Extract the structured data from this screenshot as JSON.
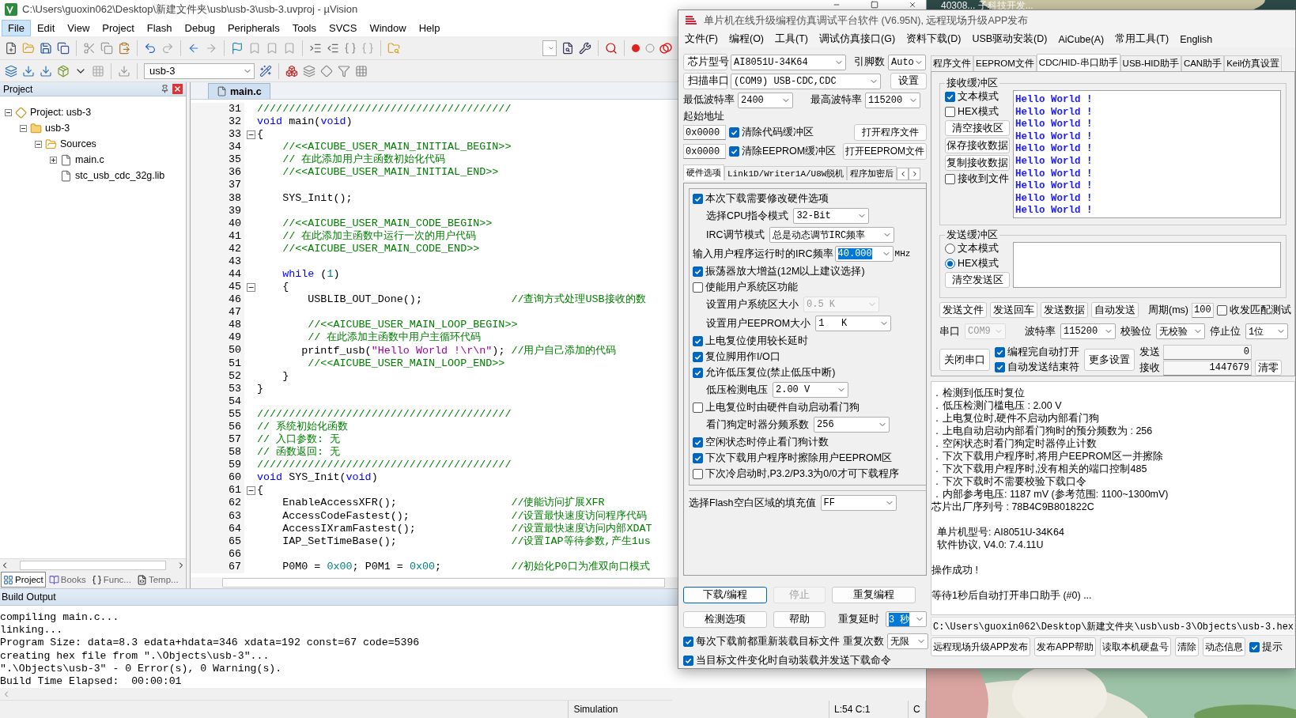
{
  "keil": {
    "title": "C:\\Users\\guoxin062\\Desktop\\新建文件夹\\usb\\usb-3\\usb-3.uvproj - µVision",
    "menu": [
      {
        "label": "File",
        "selected": true
      },
      {
        "label": "Edit",
        "selected": false
      },
      {
        "label": "View",
        "selected": false
      },
      {
        "label": "Project",
        "selected": false
      },
      {
        "label": "Flash",
        "selected": false
      },
      {
        "label": "Debug",
        "selected": false
      },
      {
        "label": "Peripherals",
        "selected": false
      },
      {
        "label": "Tools",
        "selected": false
      },
      {
        "label": "SVCS",
        "selected": false
      },
      {
        "label": "Window",
        "selected": false
      },
      {
        "label": "Help",
        "selected": false
      }
    ],
    "target": "usb-3",
    "project": {
      "title": "Project",
      "tree": [
        {
          "label": "Project: usb-3",
          "kind": "project",
          "expanded": true,
          "children": [
            {
              "label": "usb-3",
              "kind": "target",
              "expanded": true,
              "children": [
                {
                  "label": "Sources",
                  "kind": "folder",
                  "expanded": true,
                  "children": [
                    {
                      "label": "main.c",
                      "kind": "file",
                      "expanded": false
                    },
                    {
                      "label": "stc_usb_cdc_32g.lib",
                      "kind": "file"
                    }
                  ]
                }
              ]
            }
          ]
        }
      ],
      "tabs": [
        {
          "label": "Project",
          "kind": "project",
          "selected": true
        },
        {
          "label": "Books",
          "kind": "books",
          "selected": false
        },
        {
          "label": "Func...",
          "kind": "functions",
          "selected": false
        },
        {
          "label": "Temp...",
          "kind": "templates",
          "selected": false
        }
      ]
    },
    "editor": {
      "tab": "main.c",
      "lines": [
        {
          "number": "31",
          "fold": false,
          "segments": [
            {
              "kind": "comment",
              "text": "////////////////////////////////////////"
            }
          ]
        },
        {
          "number": "32",
          "fold": false,
          "segments": [
            {
              "kind": "keyword",
              "text": "void"
            },
            {
              "kind": "code",
              "text": " main("
            },
            {
              "kind": "keyword",
              "text": "void"
            },
            {
              "kind": "code",
              "text": ")"
            }
          ]
        },
        {
          "number": "33",
          "fold": true,
          "segments": [
            {
              "kind": "code",
              "text": "{"
            }
          ]
        },
        {
          "number": "34",
          "fold": false,
          "segments": [
            {
              "kind": "comment",
              "text": "    //<<AICUBE_USER_MAIN_INITIAL_BEGIN>>"
            }
          ]
        },
        {
          "number": "35",
          "fold": false,
          "segments": [
            {
              "kind": "comment",
              "text": "    // 在此添加用户主函数初始化代码"
            }
          ]
        },
        {
          "number": "36",
          "fold": false,
          "segments": [
            {
              "kind": "comment",
              "text": "    //<<AICUBE_USER_MAIN_INITIAL_END>>"
            }
          ]
        },
        {
          "number": "37",
          "fold": false
        },
        {
          "number": "38",
          "fold": false,
          "segments": [
            {
              "kind": "code",
              "text": "    SYS_Init();"
            }
          ]
        },
        {
          "number": "39",
          "fold": false
        },
        {
          "number": "40",
          "fold": false,
          "segments": [
            {
              "kind": "comment",
              "text": "    //<<AICUBE_USER_MAIN_CODE_BEGIN>>"
            }
          ]
        },
        {
          "number": "41",
          "fold": false,
          "segments": [
            {
              "kind": "comment",
              "text": "    // 在此添加主函数中运行一次的用户代码"
            }
          ]
        },
        {
          "number": "42",
          "fold": false,
          "segments": [
            {
              "kind": "comment",
              "text": "    //<<AICUBE_USER_MAIN_CODE_END>>"
            }
          ]
        },
        {
          "number": "43",
          "fold": false
        },
        {
          "number": "44",
          "fold": false,
          "segments": [
            {
              "kind": "keyword",
              "text": "    while"
            },
            {
              "kind": "code",
              "text": " ("
            },
            {
              "kind": "number",
              "text": "1"
            },
            {
              "kind": "code",
              "text": ")"
            }
          ]
        },
        {
          "number": "45",
          "fold": true,
          "segments": [
            {
              "kind": "code",
              "text": "    {"
            }
          ]
        },
        {
          "number": "46",
          "fold": false,
          "segments": [
            {
              "kind": "code",
              "text": "        USBLIB_OUT_Done();"
            }
          ],
          "note": "//查询方式处理USB接收的数"
        },
        {
          "number": "47",
          "fold": false
        },
        {
          "number": "48",
          "fold": false,
          "segments": [
            {
              "kind": "comment",
              "text": "        //<<AICUBE_USER_MAIN_LOOP_BEGIN>>"
            }
          ]
        },
        {
          "number": "49",
          "fold": false,
          "segments": [
            {
              "kind": "comment",
              "text": "        // 在此添加主函数中用户主循环代码"
            }
          ]
        },
        {
          "number": "50",
          "fold": false,
          "segments": [
            {
              "kind": "code",
              "text": "       printf_usb("
            },
            {
              "kind": "string",
              "text": "\"Hello World !\\r\\n\""
            },
            {
              "kind": "code",
              "text": ");"
            }
          ],
          "note": "//用户自己添加的代码"
        },
        {
          "number": "51",
          "fold": false,
          "segments": [
            {
              "kind": "comment",
              "text": "        //<<AICUBE_USER_MAIN_LOOP_END>>"
            }
          ]
        },
        {
          "number": "52",
          "fold": false,
          "segments": [
            {
              "kind": "code",
              "text": "    }"
            }
          ]
        },
        {
          "number": "53",
          "fold": false,
          "segments": [
            {
              "kind": "code",
              "text": "}"
            }
          ]
        },
        {
          "number": "54",
          "fold": false
        },
        {
          "number": "55",
          "fold": false,
          "segments": [
            {
              "kind": "comment",
              "text": "////////////////////////////////////////"
            }
          ]
        },
        {
          "number": "56",
          "fold": false,
          "segments": [
            {
              "kind": "comment",
              "text": "// 系统初始化函数"
            }
          ]
        },
        {
          "number": "57",
          "fold": false,
          "segments": [
            {
              "kind": "comment",
              "text": "// 入口参数: 无"
            }
          ]
        },
        {
          "number": "58",
          "fold": false,
          "segments": [
            {
              "kind": "comment",
              "text": "// 函数返回: 无"
            }
          ]
        },
        {
          "number": "59",
          "fold": false,
          "segments": [
            {
              "kind": "comment",
              "text": "////////////////////////////////////////"
            }
          ]
        },
        {
          "number": "60",
          "fold": false,
          "segments": [
            {
              "kind": "keyword",
              "text": "void"
            },
            {
              "kind": "code",
              "text": " SYS_Init("
            },
            {
              "kind": "keyword",
              "text": "void"
            },
            {
              "kind": "code",
              "text": ")"
            }
          ]
        },
        {
          "number": "61",
          "fold": true,
          "segments": [
            {
              "kind": "code",
              "text": "{"
            }
          ]
        },
        {
          "number": "62",
          "fold": false,
          "segments": [
            {
              "kind": "code",
              "text": "    EnableAccessXFR();"
            }
          ],
          "note": "//使能访问扩展XFR"
        },
        {
          "number": "63",
          "fold": false,
          "segments": [
            {
              "kind": "code",
              "text": "    AccessCodeFastest();"
            }
          ],
          "note": "//设置最快速度访问程序代码"
        },
        {
          "number": "64",
          "fold": false,
          "segments": [
            {
              "kind": "code",
              "text": "    AccessIXramFastest();"
            }
          ],
          "note": "//设置最快速度访问内部XDAT"
        },
        {
          "number": "65",
          "fold": false,
          "segments": [
            {
              "kind": "code",
              "text": "    IAP_SetTimeBase();"
            }
          ],
          "note": "//设置IAP等待参数,产生1us"
        },
        {
          "number": "66",
          "fold": false
        },
        {
          "number": "67",
          "fold": false,
          "segments": [
            {
              "kind": "code",
              "text": "    P0M0 = "
            },
            {
              "kind": "number",
              "text": "0x00"
            },
            {
              "kind": "code",
              "text": "; P0M1 = "
            },
            {
              "kind": "number",
              "text": "0x00"
            },
            {
              "kind": "code",
              "text": ";"
            }
          ],
          "note": "//初始化P0口为准双向口模式"
        }
      ]
    },
    "build_output": {
      "title": "Build Output",
      "lines": [
        "compiling main.c...",
        "linking...",
        "Program Size: data=8.3 edata+hdata=346 xdata=192 const=67 code=5396",
        "creating hex file from \".\\Objects\\usb-3\"...",
        "\".\\Objects\\usb-3\" - 0 Error(s), 0 Warning(s).",
        "Build Time Elapsed:  00:00:01"
      ]
    },
    "status_bar": {
      "mode": "Simulation",
      "position": "L:54 C:1",
      "column_3": "C"
    }
  },
  "background_window_title": "40308...  子科技开发...",
  "stc": {
    "title": "单片机在线升级编程仿真调试平台软件 (V6.95N), 远程现场升级APP发布",
    "menu": [
      "文件(F)",
      "编程(O)",
      "工具(T)",
      "调试仿真接口(G)",
      "资料下载(D)",
      "USB驱动安装(D)",
      "AiCube(A)",
      "常用工具(T)",
      "English"
    ],
    "chip": {
      "button": "芯片型号",
      "value": "AI8051U-34K64",
      "pins_label": "引脚数",
      "pins_value": "Auto"
    },
    "port": {
      "button": "扫描串口",
      "value": "(COM9) USB-CDC,CDC",
      "settings": "设置"
    },
    "baud": {
      "min_label": "最低波特率",
      "min_value": "2400",
      "max_label": "最高波特率",
      "max_value": "115200"
    },
    "start_address": {
      "label": "起始地址",
      "rows": [
        {
          "value": "0x0000",
          "check": "清除代码缓冲区",
          "checked": true,
          "button": "打开程序文件"
        },
        {
          "value": "0x0000",
          "check": "清除EEPROM缓冲区",
          "checked": true,
          "button": "打开EEPROM文件"
        }
      ]
    },
    "left_tabs": [
      {
        "label": "硬件选项",
        "selected": true
      },
      {
        "label": "Link1D/Writer1A/U8W脱机",
        "selected": false
      },
      {
        "label": "程序加密后",
        "selected": false
      }
    ],
    "hardware": [
      {
        "kind": "check",
        "label": "本次下载需要修改硬件选项",
        "checked": true
      },
      {
        "kind": "select",
        "label": "选择CPU指令模式",
        "value": "32-Bit",
        "disabled": false
      },
      {
        "kind": "select",
        "label": "IRC调节模式",
        "value": "总是动态调节IRC频率",
        "disabled": false
      },
      {
        "kind": "combo",
        "label": "输入用户程序运行时的IRC频率",
        "value": "40.000",
        "unit": "MHz",
        "text_selected": true
      },
      {
        "kind": "check",
        "label": "振荡器放大增益(12M以上建议选择)",
        "checked": true
      },
      {
        "kind": "check",
        "label": "使能用户系统区功能",
        "checked": false
      },
      {
        "kind": "select",
        "label": "设置用户系统区大小",
        "value": "0.5 K",
        "disabled": true
      },
      {
        "kind": "select",
        "label": "设置用户EEPROM大小",
        "value": "1   K",
        "disabled": false
      },
      {
        "kind": "check",
        "label": "上电复位使用较长延时",
        "checked": true
      },
      {
        "kind": "check",
        "label": "复位脚用作I/O口",
        "checked": true
      },
      {
        "kind": "check",
        "label": "允许低压复位(禁止低压中断)",
        "checked": true
      },
      {
        "kind": "select",
        "label": "低压检测电压",
        "value": "2.00 V",
        "disabled": false
      },
      {
        "kind": "check",
        "label": "上电复位时由硬件自动启动看门狗",
        "checked": false
      },
      {
        "kind": "select",
        "label": "看门狗定时器分频系数",
        "value": "256",
        "disabled": false
      },
      {
        "kind": "check",
        "label": "空闲状态时停止看门狗计数",
        "checked": true
      },
      {
        "kind": "check",
        "label": "下次下载用户程序时擦除用户EEPROM区",
        "checked": true
      },
      {
        "kind": "check",
        "label": "下次冷启动时,P3.2/P3.3为0/0才可下载程序",
        "checked": false
      }
    ],
    "fill": {
      "label": "选择Flash空白区域的填充值",
      "value": "FF"
    },
    "buttons": [
      {
        "label": "下载/编程",
        "focused": true,
        "disabled": false
      },
      {
        "label": "停止",
        "focused": false,
        "disabled": true
      },
      {
        "label": "重复编程",
        "focused": false,
        "disabled": false
      },
      {
        "label": "检测选项",
        "focused": false,
        "disabled": false
      },
      {
        "label": "帮助",
        "focused": false,
        "disabled": false
      }
    ],
    "repeat": {
      "delay_label": "重复延时",
      "delay_value": "3 秒",
      "delay_selected": true,
      "count_label": "重复次数",
      "count_value": "无限"
    },
    "auto_checks": [
      {
        "label": "每次下载前都重新装载目标文件",
        "checked": true
      },
      {
        "label": "当目标文件变化时自动装载并发送下载命令",
        "checked": true
      }
    ],
    "right_tabs": [
      {
        "label": "程序文件",
        "selected": false
      },
      {
        "label": "EEPROM文件",
        "selected": false
      },
      {
        "label": "CDC/HID-串口助手",
        "selected": true
      },
      {
        "label": "USB-HID助手",
        "selected": false
      },
      {
        "label": "CAN助手",
        "selected": false
      },
      {
        "label": "Keil仿真设置",
        "selected": false
      }
    ],
    "receive": {
      "title": "接收缓冲区",
      "options": [
        {
          "label": "文本模式",
          "checked": true
        },
        {
          "label": "HEX模式",
          "checked": false
        }
      ],
      "buttons": [
        "清空接收区",
        "保存接收数据",
        "复制接收数据"
      ],
      "to_file": {
        "label": "接收到文件",
        "checked": false
      },
      "lines": [
        "Hello World !",
        "Hello World !",
        "Hello World !",
        "Hello World !",
        "Hello World !",
        "Hello World !",
        "Hello World !",
        "Hello World !",
        "Hello World !",
        "Hello World !"
      ]
    },
    "send": {
      "title": "发送缓冲区",
      "modes": [
        {
          "label": "文本模式",
          "selected": false
        },
        {
          "label": "HEX模式",
          "selected": true
        }
      ],
      "clear": "清空发送区",
      "buttons": [
        "发送文件",
        "发送回车",
        "发送数据",
        "自动发送"
      ],
      "period_label": "周期(ms)",
      "period_value": "100",
      "match": {
        "label": "收发匹配测试",
        "checked": false
      }
    },
    "serial": {
      "port_label": "串口",
      "port_value": "COM9",
      "baud_label": "波特率",
      "baud_value": "115200",
      "parity_label": "校验位",
      "parity_value": "无校验",
      "stop_label": "停止位",
      "stop_value": "1位",
      "close": "关闭串口",
      "options": [
        {
          "label": "编程完自动打开",
          "checked": true
        },
        {
          "label": "自动发送结束符",
          "checked": true
        }
      ],
      "more": "更多设置",
      "sent_label": "发送",
      "sent_value": "0",
      "received_label": "接收",
      "received_value": "1447679",
      "reset": "清零"
    },
    "log": [
      {
        "lines": [
          {
            "bullet": ".",
            "text": "检测到低压时复位"
          },
          {
            "bullet": ".",
            "text": "低压检测门槛电压 : 2.00 V"
          },
          {
            "bullet": ".",
            "text": "上电复位时,硬件不启动内部看门狗"
          },
          {
            "bullet": ".",
            "text": "上电自动启动内部看门狗时的预分频数为 : 256"
          },
          {
            "bullet": ".",
            "text": "空闲状态时看门狗定时器停止计数"
          },
          {
            "bullet": ".",
            "text": "下次下载用户程序时,将用户EEPROM区一并擦除"
          },
          {
            "bullet": ".",
            "text": "下次下载用户程序时,没有相关的端口控制485"
          },
          {
            "bullet": ".",
            "text": "下次下载时不需要校验下载口令"
          },
          {
            "bullet": ".",
            "text": "内部参考电压: 1187 mV (参考范围: 1100~1300mV)"
          },
          {
            "text": "芯片出厂序列号 : 78B4C9B801822C"
          }
        ]
      },
      {
        "lines": [
          {
            "text": "  单片机型号: AI8051U-34K64"
          },
          {
            "text": "  软件协议, V4.0: 7.4.11U"
          }
        ]
      },
      {
        "lines": [
          {
            "text": "操作成功 !"
          }
        ]
      },
      {
        "lines": [
          {
            "text": "等待1秒后自动打开串口助手 (#0) ..."
          }
        ]
      }
    ],
    "path": "C:\\Users\\guoxin062\\Desktop\\新建文件夹\\usb\\usb-3\\Objects\\usb-3.hex",
    "bottom_buttons": [
      "远程现场升级APP发布",
      "发布APP帮助",
      "读取本机硬盘号",
      "清除",
      "动态信息"
    ],
    "tip": {
      "label": "提示",
      "checked": true
    }
  }
}
